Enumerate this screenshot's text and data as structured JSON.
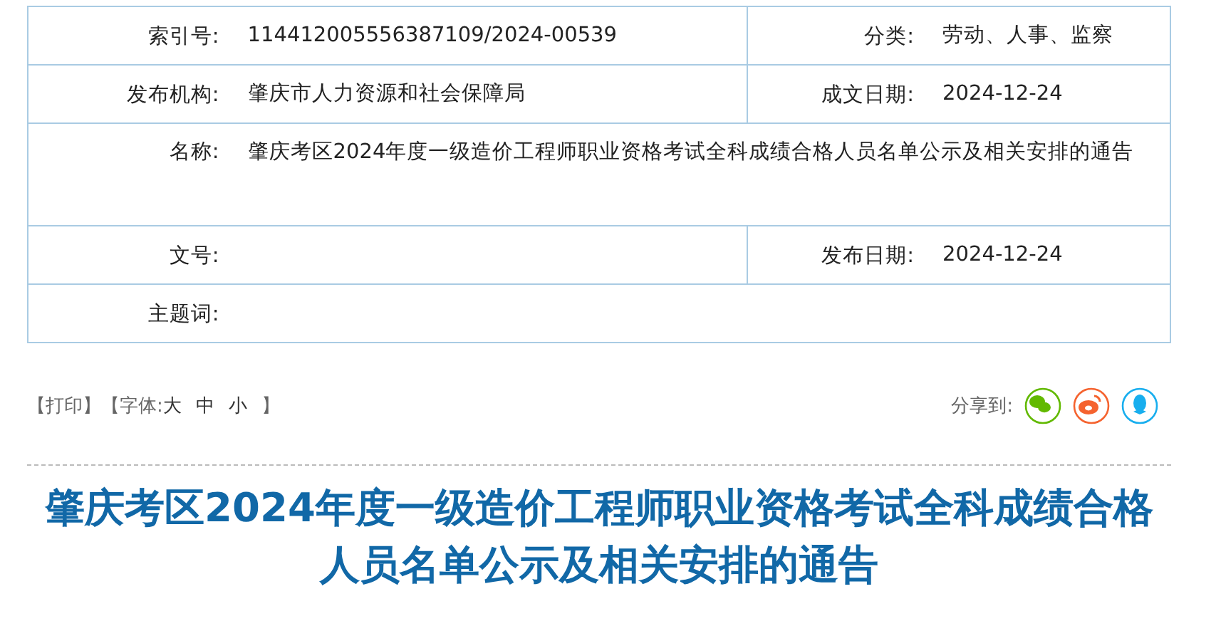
{
  "info_table": {
    "rows": [
      {
        "cells": [
          {
            "label": "索引号:",
            "value": "114412005556387109/2024-00539"
          },
          {
            "label": "分类:",
            "value": "劳动、人事、监察"
          }
        ]
      },
      {
        "cells": [
          {
            "label": "发布机构:",
            "value": "肇庆市人力资源和社会保障局"
          },
          {
            "label": "成文日期:",
            "value": "2024-12-24"
          }
        ]
      },
      {
        "cells": [
          {
            "label": "名称:",
            "value": "肇庆考区2024年度一级造价工程师职业资格考试全科成绩合格人员名单公示及相关安排的通告"
          }
        ]
      },
      {
        "cells": [
          {
            "label": "文号:"
          },
          {
            "label": "发布日期:",
            "value": "2024-12-24"
          }
        ]
      },
      {
        "cells": [
          {
            "label": "主题词:"
          }
        ]
      }
    ]
  },
  "toolbar": {
    "print": "【打印】",
    "font_label": "【字体:",
    "font_sizes": [
      "大",
      "中",
      "小"
    ],
    "font_end": "】",
    "share_label": "分享到:",
    "share": [
      {
        "kind": "wechat"
      },
      {
        "kind": "weibo"
      },
      {
        "kind": "qq"
      }
    ]
  },
  "article": {
    "title": "肇庆考区2024年度一级造价工程师职业资格考试全科成绩合格人员名单公示及相关安排的通告"
  }
}
